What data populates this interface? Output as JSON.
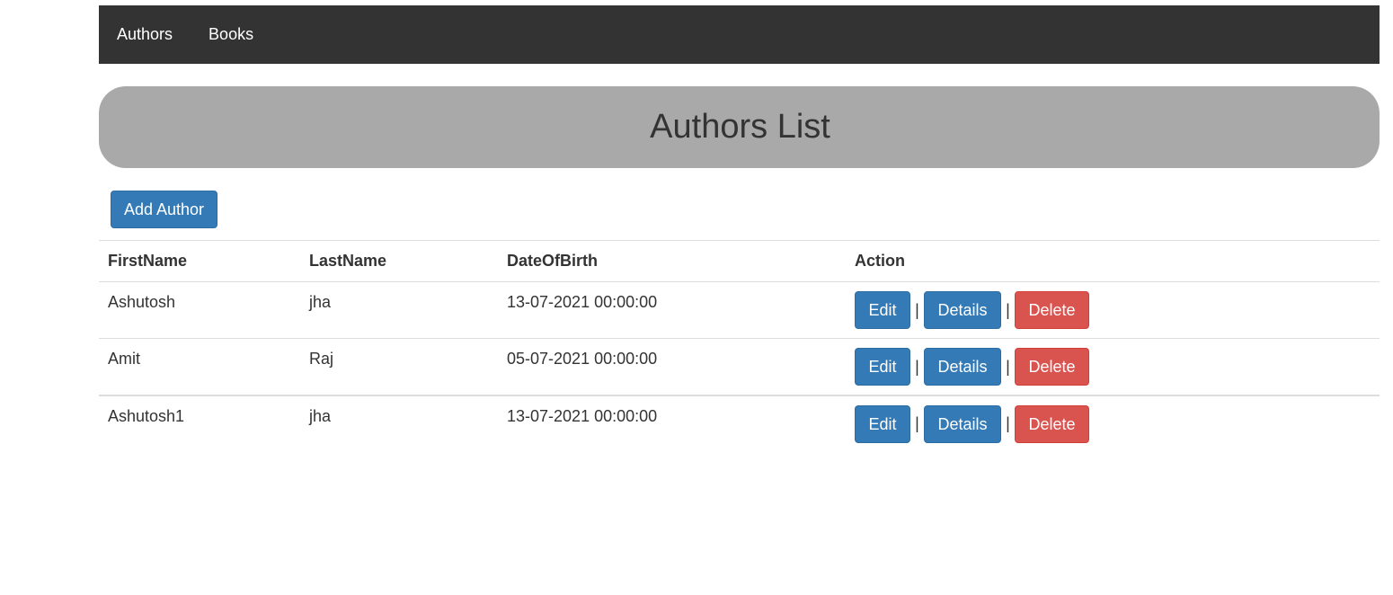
{
  "nav": {
    "items": [
      {
        "label": "Authors"
      },
      {
        "label": "Books"
      }
    ]
  },
  "page": {
    "title": "Authors List",
    "add_button": "Add Author"
  },
  "table": {
    "headers": [
      "FirstName",
      "LastName",
      "DateOfBirth",
      "Action"
    ],
    "rows": [
      {
        "first": "Ashutosh",
        "last": "jha",
        "dob": "13-07-2021 00:00:00"
      },
      {
        "first": "Amit",
        "last": "Raj",
        "dob": "05-07-2021 00:00:00"
      },
      {
        "first": "Ashutosh1",
        "last": "jha",
        "dob": "13-07-2021 00:00:00"
      }
    ],
    "actions": {
      "edit": "Edit",
      "details": "Details",
      "delete": "Delete",
      "separator": "|"
    }
  },
  "colors": {
    "navbar": "#333333",
    "banner": "#a9a9a9",
    "primary": "#337ab7",
    "danger": "#d9534f"
  }
}
